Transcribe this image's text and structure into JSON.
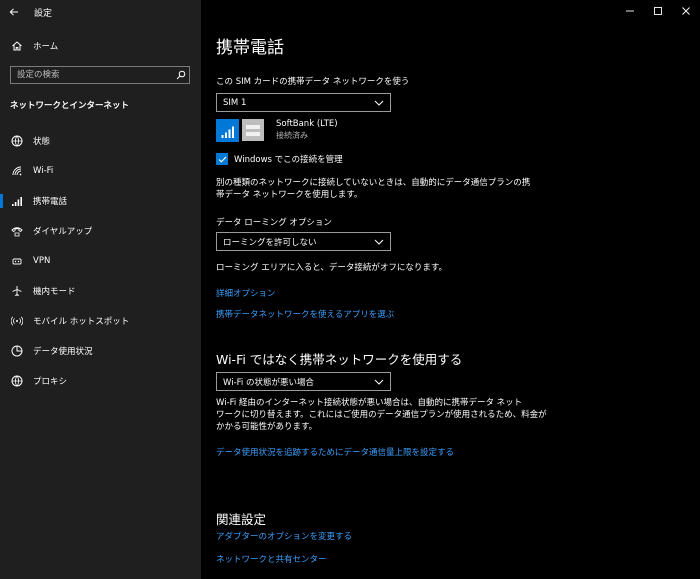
{
  "app": {
    "title": "設定"
  },
  "sidebar": {
    "home_label": "ホーム",
    "search_placeholder": "設定の検索",
    "section_title": "ネットワークとインターネット",
    "items": [
      {
        "label": "状態",
        "icon": "globe-status-icon"
      },
      {
        "label": "Wi-Fi",
        "icon": "wifi-icon"
      },
      {
        "label": "携帯電話",
        "icon": "cellular-icon",
        "active": true
      },
      {
        "label": "ダイヤルアップ",
        "icon": "dialup-icon"
      },
      {
        "label": "VPN",
        "icon": "vpn-icon"
      },
      {
        "label": "機内モード",
        "icon": "airplane-icon"
      },
      {
        "label": "モバイル ホットスポット",
        "icon": "hotspot-icon"
      },
      {
        "label": "データ使用状況",
        "icon": "data-usage-icon"
      },
      {
        "label": "プロキシ",
        "icon": "proxy-globe-icon"
      }
    ]
  },
  "main": {
    "page_title": "携帯電話",
    "sim_label": "この SIM カードの携帯データ ネットワークを使う",
    "sim_dropdown": "SIM 1",
    "carrier_name": "SoftBank (LTE)",
    "carrier_status": "接続済み",
    "manage_checkbox_label": "Windows でこの接続を管理",
    "manage_checked": true,
    "auto_desc_1": "別の種類のネットワークに接続していないときは、自動的にデータ通信プランの携",
    "auto_desc_2": "帯データ ネットワークを使用します。",
    "roaming_label": "データ ローミング オプション",
    "roaming_dropdown": "ローミングを許可しない",
    "roaming_desc": "ローミング エリアに入ると、データ接続がオフになります。",
    "advanced_link": "詳細オプション",
    "apps_link": "携帯データネットワークを使えるアプリを選ぶ",
    "wifi_heading": "Wi-Fi ではなく携帯ネットワークを使用する",
    "wifi_dropdown": "Wi-Fi の状態が悪い場合",
    "wifi_desc_1": "Wi-Fi 経由のインターネット接続状態が悪い場合は、自動的に携帯データ ネット",
    "wifi_desc_2": "ワークに切り替えます。これにはご使用のデータ通信プランが使用されるため、料金が",
    "wifi_desc_3": "かかる可能性があります。",
    "data_limit_link": "データ使用状況を追跡するためにデータ通信量上限を設定する",
    "related_heading": "関連設定",
    "adapter_link": "アダプターのオプションを変更する",
    "network_center_link": "ネットワークと共有センター"
  },
  "colors": {
    "accent": "#0078d7",
    "link": "#3aa0ff",
    "sidebar_bg": "#1f1f1f",
    "main_bg": "#000000"
  }
}
